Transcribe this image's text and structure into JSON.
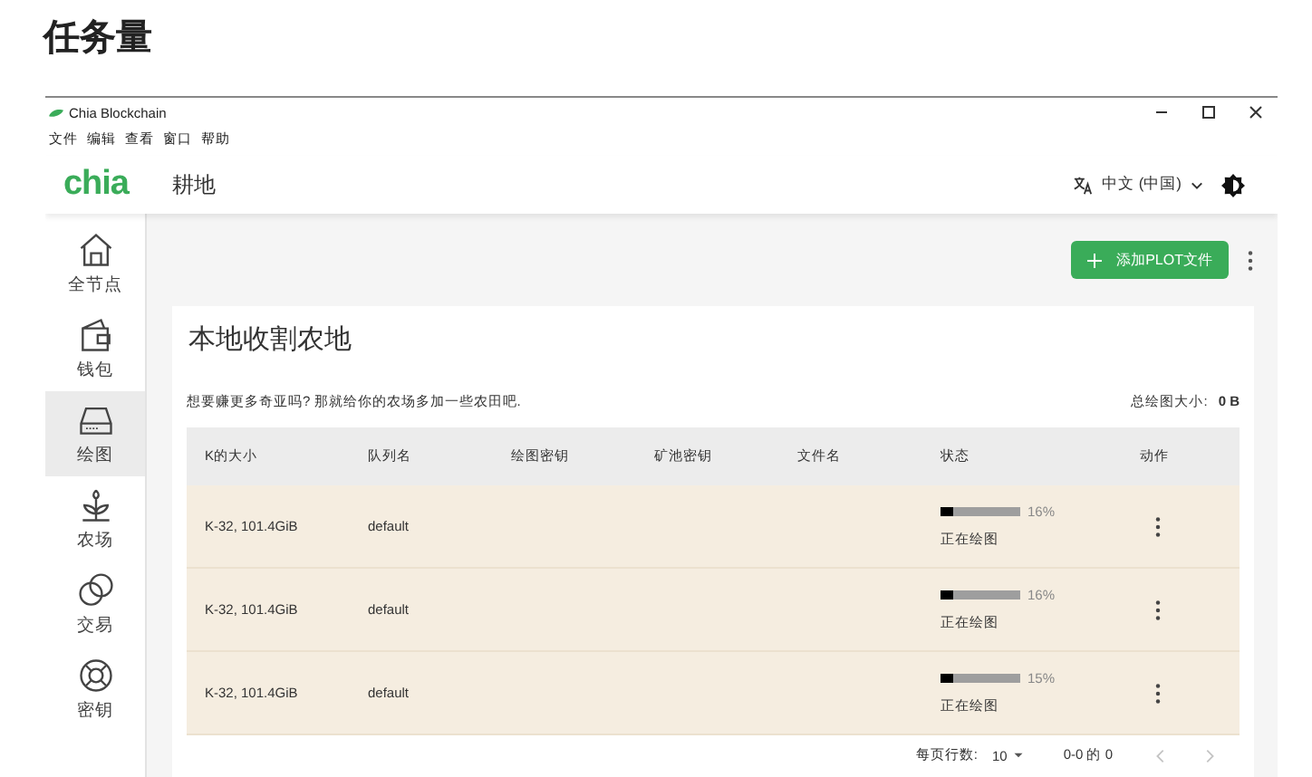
{
  "page_title": "任务量",
  "window": {
    "title": "Chia Blockchain"
  },
  "menu": [
    "文件",
    "编辑",
    "查看",
    "窗口",
    "帮助"
  ],
  "logo": "chia",
  "header": {
    "title": "耕地",
    "language": "中文 (中国)"
  },
  "sidebar": {
    "items": [
      {
        "label": "全节点",
        "kind": "home",
        "selected": false
      },
      {
        "label": "钱包",
        "kind": "wallet",
        "selected": false
      },
      {
        "label": "绘图",
        "kind": "drive",
        "selected": true
      },
      {
        "label": "农场",
        "kind": "plant",
        "selected": false
      },
      {
        "label": "交易",
        "kind": "rings",
        "selected": false
      },
      {
        "label": "密钥",
        "kind": "lifebuoy",
        "selected": false
      }
    ]
  },
  "toolbar": {
    "add_button": "添加PLOT文件"
  },
  "card": {
    "title": "本地收割农地",
    "description": "想要赚更多奇亚吗? 那就给你的农场多加一些农田吧.",
    "total_label": "总绘图大小:",
    "total_value": "0 B"
  },
  "table": {
    "columns": [
      "K的大小",
      "队列名",
      "绘图密钥",
      "矿池密钥",
      "文件名",
      "状态",
      "动作"
    ],
    "rows": [
      {
        "k_size": "K-32, 101.4GiB",
        "queue": "default",
        "level": 0.16,
        "percent": "16%",
        "status": "正在绘图"
      },
      {
        "k_size": "K-32, 101.4GiB",
        "queue": "default",
        "level": 0.16,
        "percent": "16%",
        "status": "正在绘图"
      },
      {
        "k_size": "K-32, 101.4GiB",
        "queue": "default",
        "level": 0.15,
        "percent": "15%",
        "status": "正在绘图"
      }
    ]
  },
  "pagination": {
    "rows_per_page_label": "每页行数:",
    "rows_per_page": "10",
    "range": "0-0 的 0",
    "previous_disabled": true,
    "next_disabled": true
  }
}
